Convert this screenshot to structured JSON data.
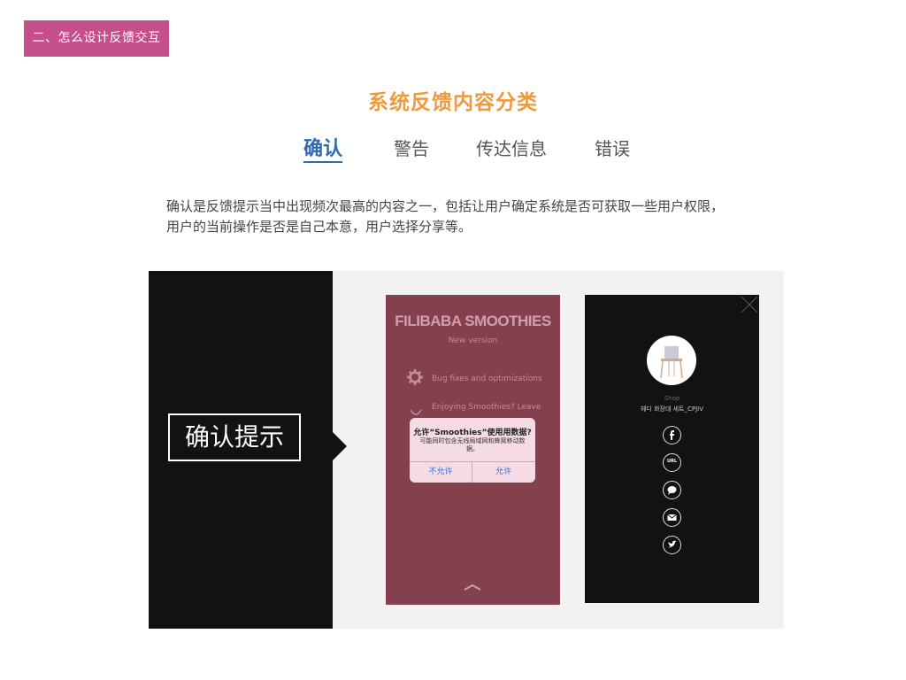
{
  "badge": {
    "label": "二、怎么设计反馈交互"
  },
  "title": "系统反馈内容分类",
  "tabs": [
    {
      "label": "确认",
      "active": true
    },
    {
      "label": "警告",
      "active": false
    },
    {
      "label": "传达信息",
      "active": false
    },
    {
      "label": "错误",
      "active": false
    }
  ],
  "description": {
    "line1": "确认是反馈提示当中出现频次最高的内容之一，包括让用户确定系统是否可获取一些用户权限，",
    "line2": "用户的当前操作是否是自己本意，用户选择分享等。"
  },
  "example": {
    "confirm_label": "确认提示",
    "phone1": {
      "app_title": "FILIBABA SMOOTHIES",
      "app_subtitle": "New version",
      "feature1": "Bug fixes and optimizations",
      "feature2": "Enjoying Smoothies? Leave",
      "dialog": {
        "title": "允许“Smoothies”使用用数据?",
        "message": "可能同时包含无线局域网和蜂窝移动数据。",
        "deny": "不允许",
        "allow": "允许"
      }
    },
    "phone2": {
      "shop_label": "Shop",
      "product_name": "헤디 화장대 세트_CPJIV",
      "share_icons": [
        "facebook-icon",
        "url-icon",
        "message-icon",
        "mail-icon",
        "twitter-icon"
      ],
      "url_label": "URL"
    }
  },
  "colors": {
    "badge": "#c54f8b",
    "title": "#ee9a3c",
    "active_tab": "#2f6ab3",
    "phone1_bg": "#84404f",
    "dialog_bg": "#f5dbe3",
    "dark_panel": "#121214"
  }
}
